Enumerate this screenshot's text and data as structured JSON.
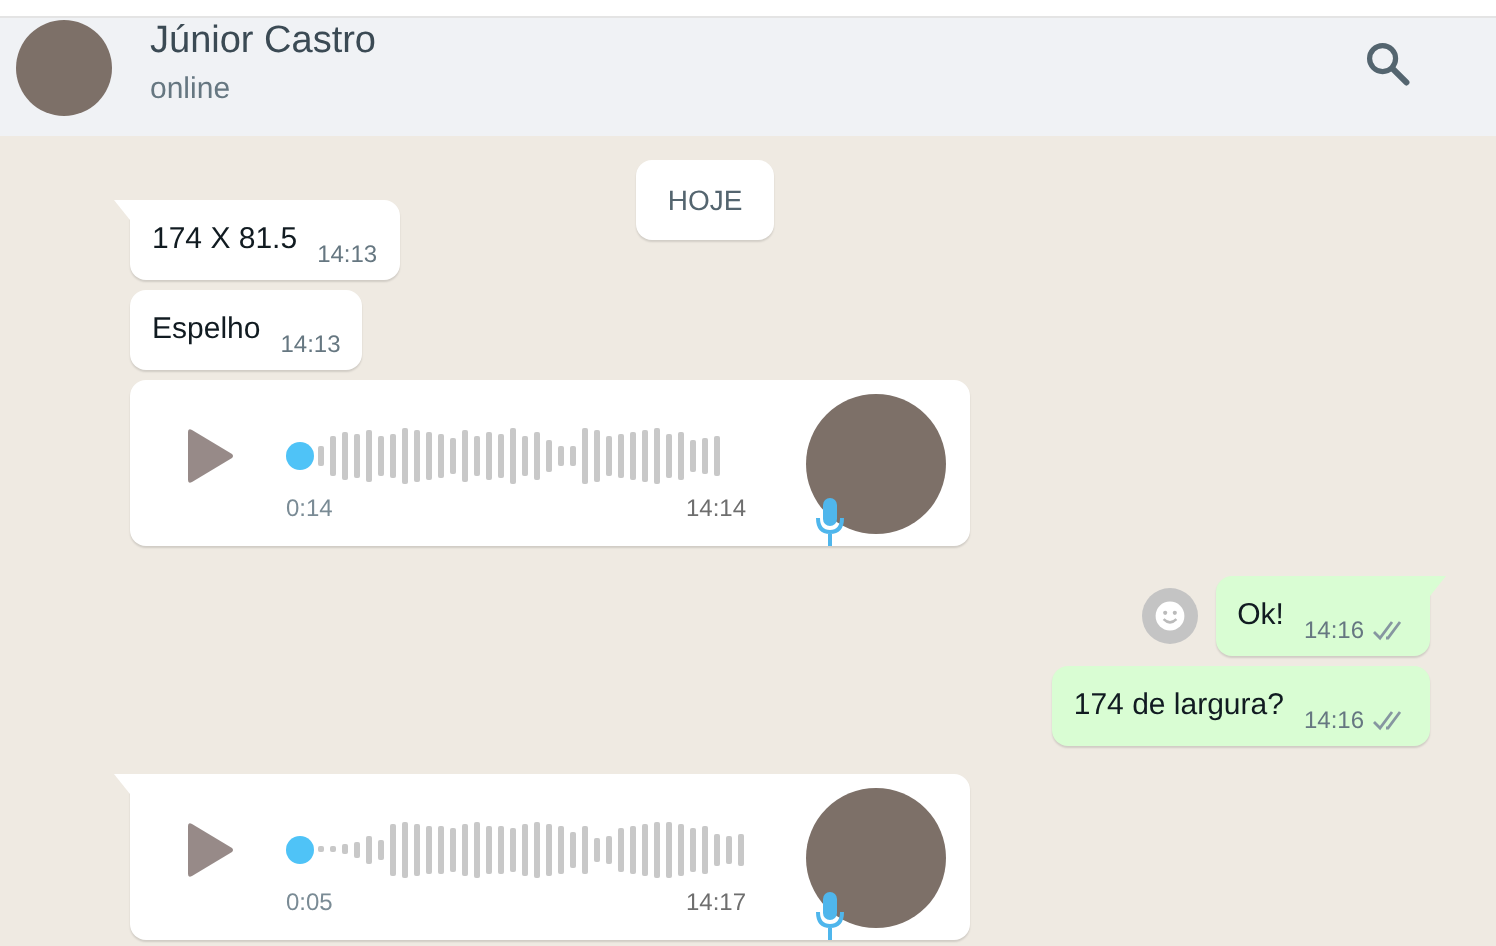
{
  "header": {
    "name": "Júnior Castro",
    "status": "online"
  },
  "messages": [
    {
      "kind": "date",
      "text": "HOJE"
    },
    {
      "kind": "text",
      "outgoing": false,
      "tail": true,
      "text": "174 X 81.5",
      "time": "14:13"
    },
    {
      "kind": "text",
      "outgoing": false,
      "tail": false,
      "text": "Espelho",
      "time": "14:13"
    },
    {
      "kind": "voice",
      "outgoing": false,
      "tail": false,
      "duration": "0:14",
      "time": "14:14"
    },
    {
      "kind": "text",
      "outgoing": true,
      "tail": true,
      "reaction_button": true,
      "text": "Ok!",
      "time": "14:16"
    },
    {
      "kind": "text",
      "outgoing": true,
      "tail": false,
      "text": "174 de largura?",
      "time": "14:16"
    },
    {
      "kind": "voice",
      "outgoing": false,
      "tail": true,
      "duration": "0:05",
      "time": "14:17"
    }
  ]
}
